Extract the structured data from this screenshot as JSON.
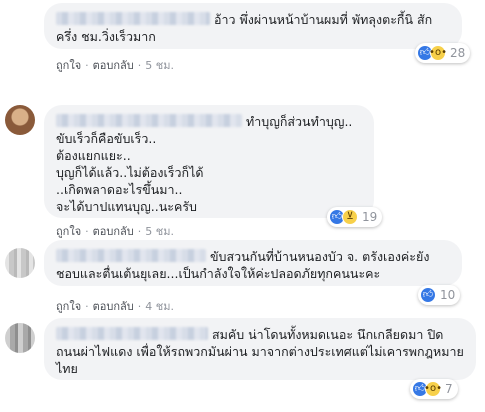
{
  "comments": [
    {
      "text": "อ้าว พึ่งผ่านหน้าบ้านผมที่ พัทลุงตะกี้นิ สักครึ่ง ชม.วิ่งเร็วมาก",
      "reactions": {
        "icons": [
          "like-icon",
          "wow-icon"
        ],
        "count": "28"
      },
      "like_label": "ถูกใจ",
      "reply_label": "ตอบกลับ",
      "time": "5 ชม."
    },
    {
      "text": "ทำบุญก็ส่วนทำบุญ..\nขับเร็วก็คือขับเร็ว..\nต้องแยกแยะ..\nบุญก็ได้แล้ว..ไม่ต้องเร็วก็ได้\n..เกิดพลาดอะไรขึ้นมา..\nจะได้บาปแทนบุญ..นะครับ",
      "reactions": {
        "icons": [
          "like-icon",
          "haha-icon"
        ],
        "count": "19"
      },
      "like_label": "ถูกใจ",
      "reply_label": "ตอบกลับ",
      "time": "5 ชม."
    },
    {
      "text": "ขับสวนกันที่บ้านหนองบัว จ. ตรังเองค่ะยังชอบและตื่นเต้นยุเลย...เป็นกำลังใจให้ค่ะปลอดภัยทุกคนนะคะ",
      "reactions": {
        "icons": [
          "like-icon"
        ],
        "count": "10"
      },
      "like_label": "ถูกใจ",
      "reply_label": "ตอบกลับ",
      "time": "4 ชม."
    },
    {
      "text": "สมคับ น่าโดนทั้งหมดเนอะ นึกเกลียดมา ปิดถนนผ่าไฟแดง เพื่อให้รถพวกมันผ่าน มาจากต่างประเทศแต่ไม่เคารพกฎหมายไทย",
      "reactions": {
        "icons": [
          "like-icon",
          "wow-icon"
        ],
        "count": "7"
      },
      "like_label": "",
      "reply_label": "",
      "time": ""
    }
  ],
  "colors": {
    "bubble": "#f2f3f5",
    "like_blue": "#3578e5",
    "meta_gray": "#90949c",
    "action_text": "#4b4f56"
  }
}
